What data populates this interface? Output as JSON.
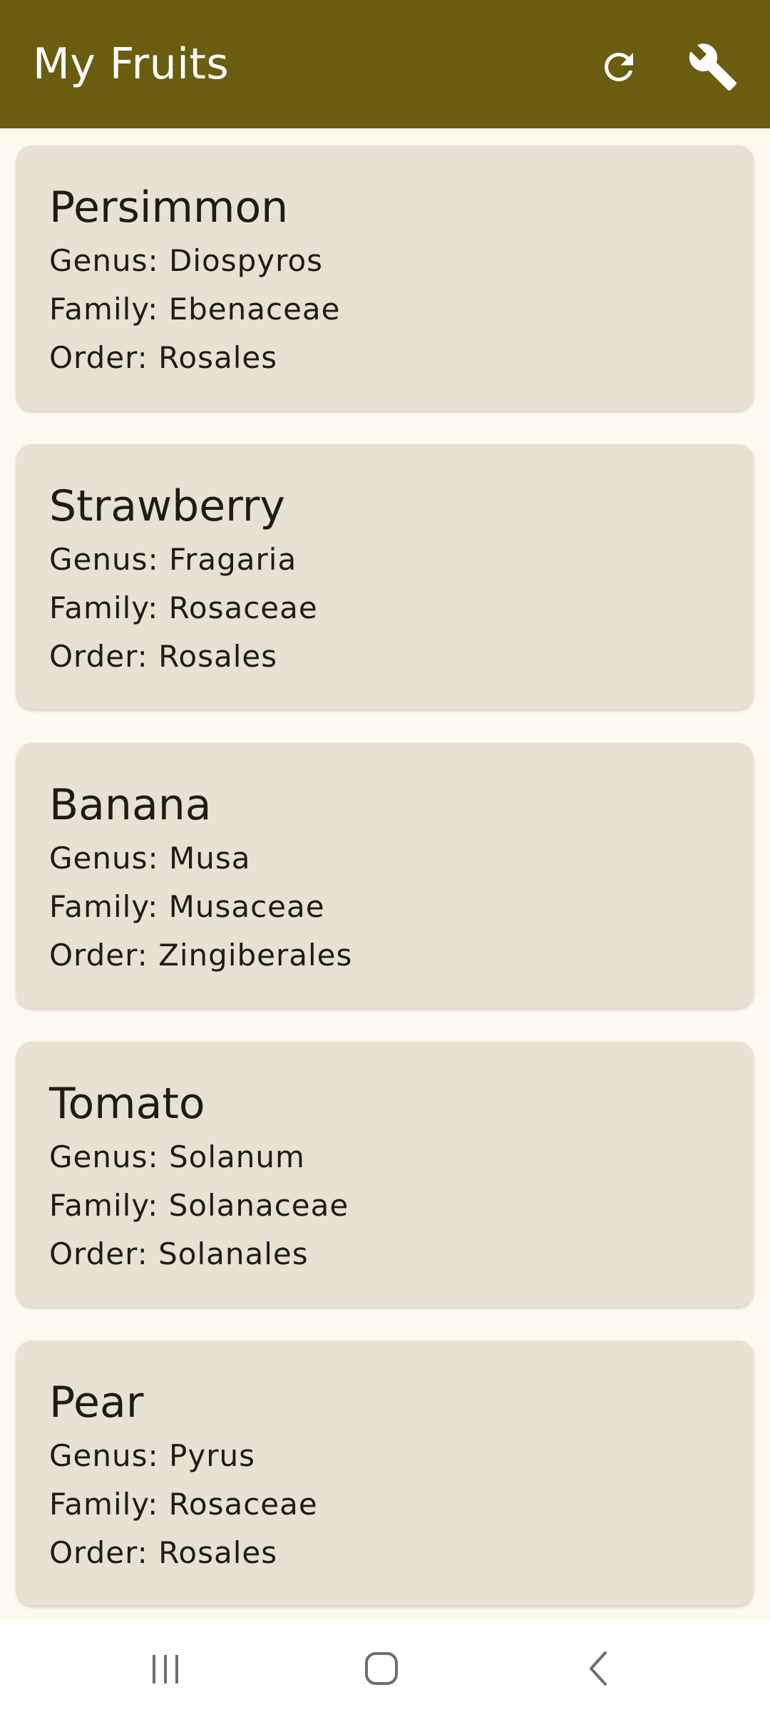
{
  "app_bar": {
    "title": "My Fruits",
    "actions": [
      {
        "icon": "refresh-icon"
      },
      {
        "icon": "wrench-icon"
      }
    ],
    "background_color": "#6B5D10"
  },
  "fruits": [
    {
      "name": "Persimmon",
      "genus": "Genus: Diospyros",
      "family": "Family: Ebenaceae",
      "order": "Order: Rosales"
    },
    {
      "name": "Strawberry",
      "genus": "Genus: Fragaria",
      "family": "Family: Rosaceae",
      "order": "Order: Rosales"
    },
    {
      "name": "Banana",
      "genus": "Genus: Musa",
      "family": "Family: Musaceae",
      "order": "Order: Zingiberales"
    },
    {
      "name": "Tomato",
      "genus": "Genus: Solanum",
      "family": "Family: Solanaceae",
      "order": "Order: Solanales"
    },
    {
      "name": "Pear",
      "genus": "Genus: Pyrus",
      "family": "Family: Rosaceae",
      "order": "Order: Rosales"
    }
  ],
  "colors": {
    "background": "#FDF9EE",
    "card": "#E8E2D3",
    "text": "#1E1C13"
  },
  "system_nav": {
    "buttons": [
      {
        "icon": "recents-icon"
      },
      {
        "icon": "home-icon"
      },
      {
        "icon": "back-icon"
      }
    ]
  }
}
